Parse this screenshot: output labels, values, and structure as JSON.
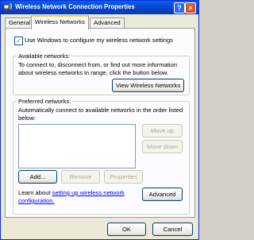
{
  "window": {
    "title": "Wireless Network Connection Properties",
    "help_label": "?",
    "close_label": "×"
  },
  "tabs": [
    {
      "label": "General"
    },
    {
      "label": "Wireless Networks",
      "active": true
    },
    {
      "label": "Advanced"
    }
  ],
  "options": {
    "use_windows_label": "Use Windows to configure my wireless network settings",
    "use_windows_checked": true,
    "check_mark": "✓"
  },
  "available": {
    "heading": "Available networks:",
    "line1": "To connect to, disconnect from, or find out more information",
    "line2": "about wireless networks in range, click the button below.",
    "view_button": "View Wireless Networks"
  },
  "preferred": {
    "heading": "Preferred networks:",
    "line1": "Automatically connect to available networks in the order listed",
    "line2": "below:",
    "move_up": "Move up",
    "move_down": "Move down",
    "add": "Add...",
    "remove": "Remove",
    "properties": "Properties"
  },
  "learn": {
    "prefix": "Learn about ",
    "link_line1": "setting up wireless network",
    "link_line2": "configuration.",
    "advanced_button": "Advanced"
  },
  "footer": {
    "ok": "OK",
    "cancel": "Cancel"
  }
}
